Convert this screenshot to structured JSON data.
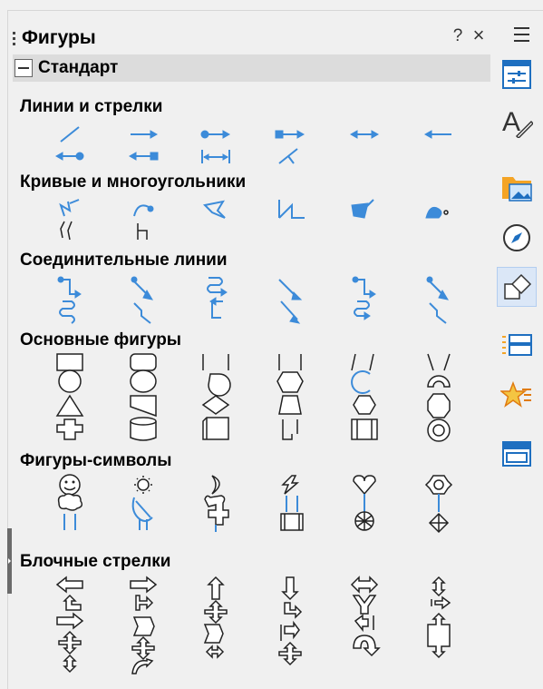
{
  "panel": {
    "title": "Фигуры",
    "help_label": "?",
    "close_label": "×"
  },
  "category": {
    "label": "Стандарт"
  },
  "sections": [
    {
      "title": "Линии и стрелки"
    },
    {
      "title": "Кривые и многоугольники"
    },
    {
      "title": "Соединительные линии"
    },
    {
      "title": "Основные фигуры"
    },
    {
      "title": "Фигуры-символы"
    },
    {
      "title": "Блочные стрелки"
    }
  ],
  "sidebar": {
    "items": [
      {
        "name": "properties",
        "icon": "properties-icon"
      },
      {
        "name": "styles",
        "icon": "styles-icon"
      },
      {
        "name": "gallery",
        "icon": "gallery-icon"
      },
      {
        "name": "navigator",
        "icon": "navigator-icon"
      },
      {
        "name": "shapes",
        "icon": "shapes-icon",
        "active": true
      },
      {
        "name": "slide-transition",
        "icon": "slide-transition-icon"
      },
      {
        "name": "animation",
        "icon": "animation-icon"
      },
      {
        "name": "master-slides",
        "icon": "master-slides-icon"
      }
    ]
  },
  "colors": {
    "accent": "#3c8bd9",
    "panel_bg": "#f0f0f0",
    "category_bg": "#dcdcdc",
    "active_bg": "#dbe7f7"
  }
}
